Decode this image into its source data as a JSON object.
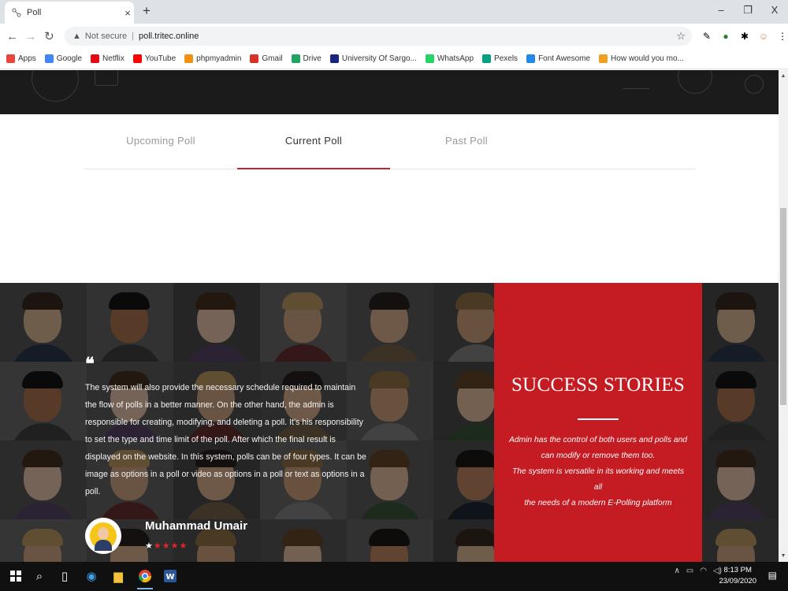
{
  "browser": {
    "tab_title": "Poll",
    "tab_close": "×",
    "new_tab": "+",
    "win_minimize": "–",
    "win_restore": "❐",
    "win_close": "X",
    "security_label": "Not secure",
    "url": "poll.tritec.online",
    "bookmarks": [
      {
        "label": "Apps",
        "icon": "apps-grid-icon",
        "color": "#e8453c"
      },
      {
        "label": "Google",
        "icon": "google-icon",
        "color": "#4285f4"
      },
      {
        "label": "Netflix",
        "icon": "netflix-icon",
        "color": "#e50914"
      },
      {
        "label": "YouTube",
        "icon": "youtube-icon",
        "color": "#ff0000"
      },
      {
        "label": "phpmyadmin",
        "icon": "phpmyadmin-icon",
        "color": "#f29111"
      },
      {
        "label": "Gmail",
        "icon": "gmail-icon",
        "color": "#d93025"
      },
      {
        "label": "Drive",
        "icon": "drive-icon",
        "color": "#1fa463"
      },
      {
        "label": "University Of Sargo...",
        "icon": "university-icon",
        "color": "#1a237e"
      },
      {
        "label": "WhatsApp",
        "icon": "whatsapp-icon",
        "color": "#25d366"
      },
      {
        "label": "Pexels",
        "icon": "pexels-icon",
        "color": "#05a081"
      },
      {
        "label": "Font Awesome",
        "icon": "font-awesome-icon",
        "color": "#228ae6"
      },
      {
        "label": "How would you mo...",
        "icon": "bookmark-page-icon",
        "color": "#f0a020"
      }
    ]
  },
  "poll_tabs": [
    {
      "label": "Upcoming Poll",
      "active": false
    },
    {
      "label": "Current Poll",
      "active": true
    },
    {
      "label": "Past Poll",
      "active": false
    }
  ],
  "testimonial": {
    "quote_mark": "❝",
    "text": "The system will also provide the necessary schedule required to maintain the flow of polls in a better manner. On the other hand, the admin is responsible for creating, modifying, and deleting a poll. It's his responsibility to set the type and time limit of the poll. After which the final result is displayed on the website. In this system, polls can be of four types. It can be image as options in a poll or video as options in a poll or text as options in a poll.",
    "author": "Muhammad Umair",
    "rating": 5,
    "star": "★"
  },
  "success": {
    "title": "SUCCESS STORIES",
    "lines": [
      "Admin has the control of both users and polls and",
      "can modify or remove them too.",
      "The system is versatile in its working and meets all",
      "the needs of a modern E-Polling platform"
    ]
  },
  "taskbar": {
    "time": "8:13 PM",
    "date": "23/09/2020"
  },
  "colors": {
    "accent_red": "#c51b22",
    "active_tab_underline": "#c0272d"
  }
}
